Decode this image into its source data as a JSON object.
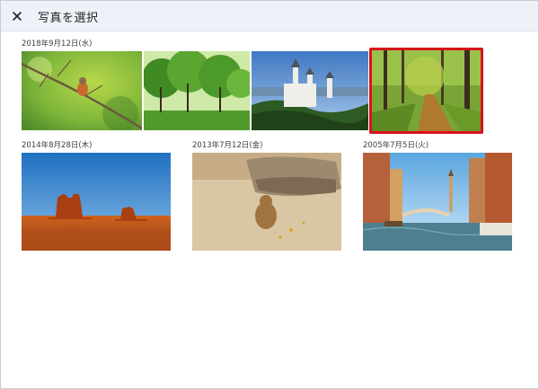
{
  "header": {
    "title": "写真を選択",
    "close_icon": "close-icon"
  },
  "groups": [
    {
      "date": "2018年9月12日(水)",
      "photos": [
        {
          "subject": "bird-on-branch",
          "selected": false
        },
        {
          "subject": "park-trees",
          "selected": false
        },
        {
          "subject": "castle",
          "selected": false
        },
        {
          "subject": "forest-path",
          "selected": true
        }
      ]
    },
    {
      "date": "2014年8月28日(木)",
      "photos": [
        {
          "subject": "desert-buttes",
          "selected": false
        }
      ]
    },
    {
      "date": "2013年7月12日(金)",
      "photos": [
        {
          "subject": "prairie-dog-on-sand",
          "selected": false
        }
      ]
    },
    {
      "date": "2005年7月5日(火)",
      "photos": [
        {
          "subject": "venice-canal",
          "selected": false
        }
      ]
    }
  ],
  "colors": {
    "selection_border": "#d8131b",
    "header_bg": "#eef2f8",
    "text": "#202124"
  }
}
